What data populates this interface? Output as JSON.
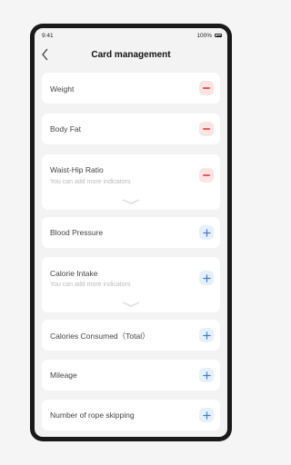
{
  "status": {
    "time": "9:41",
    "battery_pct": "100%"
  },
  "header": {
    "title": "Card management",
    "back_icon": "chevron-left-icon"
  },
  "colors": {
    "remove": "#e85a5a",
    "add": "#3d7fd9"
  },
  "cards": [
    {
      "label": "Weight",
      "action": "remove"
    },
    {
      "label": "Body Fat",
      "action": "remove"
    },
    {
      "label": "Waist-Hip Ratio",
      "sub": "You can add more indicators",
      "action": "remove"
    },
    {
      "label": "Blood Pressure",
      "action": "add"
    },
    {
      "label": "Calorie Intake",
      "sub": "You can add more indicators",
      "action": "add"
    },
    {
      "label": "Calories Consumed（Total）",
      "action": "add"
    },
    {
      "label": "Mileage",
      "action": "add"
    },
    {
      "label": "Number of rope skipping",
      "action": "add"
    }
  ]
}
